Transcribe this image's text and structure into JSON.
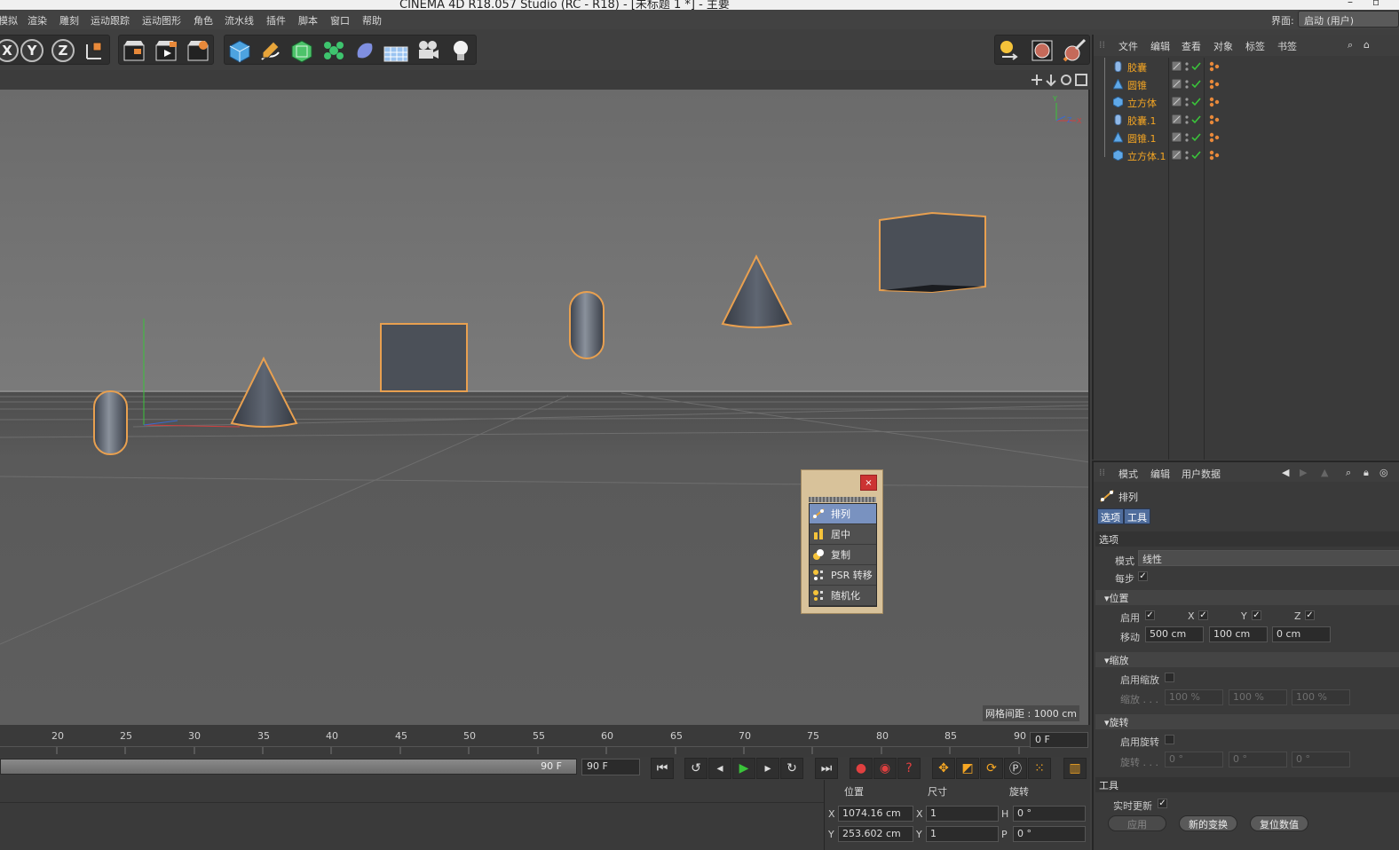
{
  "window": {
    "title": "CINEMA 4D R18.057 Studio (RC - R18) - [未标题 1 *] - 主要",
    "controls": [
      "–",
      "▫"
    ]
  },
  "menu": [
    "模拟",
    "渲染",
    "雕刻",
    "运动跟踪",
    "运动图形",
    "角色",
    "流水线",
    "插件",
    "脚本",
    "窗口",
    "帮助"
  ],
  "layout": {
    "label": "界面:",
    "value": "启动 (用户)"
  },
  "toolbar": {
    "axis": [
      "X",
      "Y",
      "Z"
    ],
    "icons": [
      "coordinate-system-icon",
      "render-view-icon",
      "render-picture-viewer-icon",
      "render-settings-icon",
      "cube-primitive-icon",
      "pen-spline-icon",
      "subdivision-icon",
      "cloner-icon",
      "deformer-icon",
      "floor-icon",
      "camera-icon",
      "light-icon",
      "axis-icon",
      "texture-icon",
      "paint-icon"
    ]
  },
  "viewport": {
    "grid_spacing": "网格间距 : 1000 cm",
    "axis_y": "Y",
    "axis_z": "Z",
    "axis_x": "X"
  },
  "popup": {
    "close": "×",
    "items": [
      {
        "label": "排列",
        "icon": "arrange-icon",
        "selected": true
      },
      {
        "label": "居中",
        "icon": "center-icon",
        "selected": false
      },
      {
        "label": "复制",
        "icon": "duplicate-icon",
        "selected": false
      },
      {
        "label": "PSR 转移",
        "icon": "transfer-psr-icon",
        "selected": false
      },
      {
        "label": "随机化",
        "icon": "randomize-icon",
        "selected": false
      }
    ]
  },
  "timeline": {
    "ticks": [
      "20",
      "25",
      "30",
      "35",
      "40",
      "45",
      "50",
      "55",
      "60",
      "65",
      "70",
      "75",
      "80",
      "85",
      "90"
    ],
    "current_frame": "0 F",
    "range_end_label": "90 F",
    "range_end": "90 F"
  },
  "coords": {
    "headers": {
      "position": "位置",
      "size": "尺寸",
      "rotation": "旋转"
    },
    "rows": [
      {
        "axis": "X",
        "pos": "1074.16 cm",
        "size_axis": "X",
        "size": "1",
        "rot_axis": "H",
        "rot": "0 °"
      },
      {
        "axis": "Y",
        "pos": "253.602 cm",
        "size_axis": "Y",
        "size": "1",
        "rot_axis": "P",
        "rot": "0 °"
      }
    ]
  },
  "objects": {
    "menu": [
      "文件",
      "编辑",
      "查看",
      "对象",
      "标签",
      "书签"
    ],
    "items": [
      {
        "name": "胶囊",
        "type": "capsule"
      },
      {
        "name": "圆锥",
        "type": "cone"
      },
      {
        "name": "立方体",
        "type": "cube"
      },
      {
        "name": "胶囊.1",
        "type": "capsule"
      },
      {
        "name": "圆锥.1",
        "type": "cone"
      },
      {
        "name": "立方体.1",
        "type": "cube"
      }
    ]
  },
  "attributes": {
    "menu": [
      "模式",
      "编辑",
      "用户数据"
    ],
    "title": "排列",
    "tabs": [
      "选项",
      "工具"
    ],
    "section_options": "选项",
    "mode_label": "模式",
    "mode_value": "线性",
    "per_step_label": "每步",
    "position": {
      "title": "位置",
      "enable_label": "启用",
      "x": "X",
      "y": "Y",
      "z": "Z",
      "move_label": "移动",
      "move": [
        "500 cm",
        "100 cm",
        "0 cm"
      ]
    },
    "scale": {
      "title": "缩放",
      "enable_label": "启用缩放",
      "label": "缩放 . . .",
      "values": [
        "100 %",
        "100 %",
        "100 %"
      ]
    },
    "rotation": {
      "title": "旋转",
      "enable_label": "启用旋转",
      "label": "旋转 . . .",
      "values": [
        "0 °",
        "0 °",
        "0 °"
      ]
    },
    "tool": {
      "title": "工具",
      "realtime_label": "实时更新",
      "apply": "应用",
      "new_transform": "新的变换",
      "reset": "复位数值"
    }
  },
  "colors": {
    "accent": "#f5a623",
    "selection": "#7992c0",
    "tab": "#4f6d9c"
  }
}
